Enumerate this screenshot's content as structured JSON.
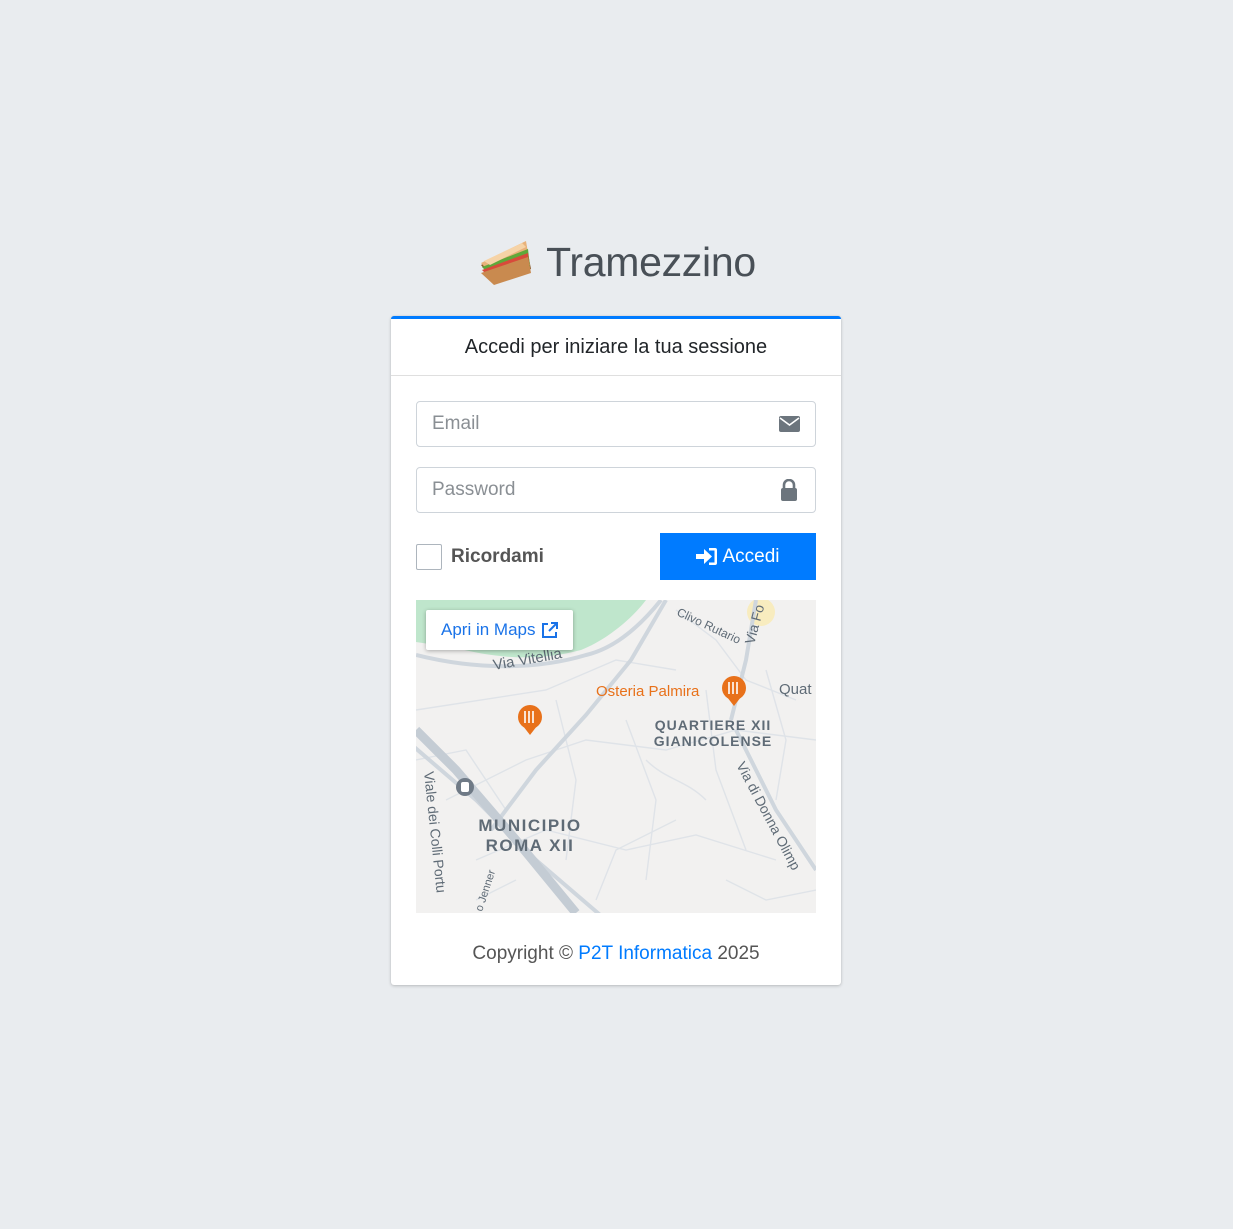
{
  "brand": {
    "name": "Tramezzino",
    "logo_icon": "sandwich-icon"
  },
  "card": {
    "header": "Accedi per iniziare la tua sessione"
  },
  "form": {
    "email": {
      "placeholder": "Email",
      "value": "",
      "icon": "envelope-icon"
    },
    "password": {
      "placeholder": "Password",
      "value": "",
      "icon": "lock-icon"
    },
    "remember": {
      "label": "Ricordami",
      "checked": false
    },
    "submit": {
      "label": "Accedi",
      "icon": "sign-in-icon"
    }
  },
  "map": {
    "open_link": {
      "label": "Apri in Maps",
      "icon": "external-link-icon"
    },
    "labels": {
      "road_vitellia": "Via Vitellia",
      "clivo_rutario": "Clivo Rutario",
      "via_fo": "Via Fo",
      "osteria": "Osteria Palmira",
      "quat": "Quat",
      "quartiere_1": "QUARTIERE XII",
      "quartiere_2": "GIANICOLENSE",
      "viale_colli": "Viale dei Colli Portu",
      "municipio_1": "MUNICIPIO",
      "municipio_2": "ROMA XII",
      "donna_olimpia": "Via di Donna Olimp",
      "jenner": "o Jenner"
    }
  },
  "footer": {
    "prefix": "Copyright © ",
    "company": "P2T Informatica",
    "year": " 2025"
  },
  "colors": {
    "primary": "#007bff",
    "background": "#e9ecef",
    "poi": "#e8711a"
  }
}
